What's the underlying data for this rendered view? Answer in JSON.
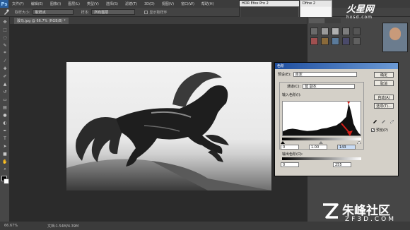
{
  "app": {
    "logo": "Ps"
  },
  "menu": [
    "文件(F)",
    "编辑(E)",
    "图像(I)",
    "图层(L)",
    "类型(Y)",
    "选择(S)",
    "滤镜(T)",
    "3D(D)",
    "视图(V)",
    "窗口(W)",
    "帮助(H)"
  ],
  "options": {
    "size_label": "取样大小:",
    "size_value": "取样点",
    "sample_label": "样本:",
    "sample_value": "所有图层",
    "show_ring": "显示取样环"
  },
  "document": {
    "tab": "骏马.jpg @ 66.7% (RGB/8) *"
  },
  "status": {
    "zoom": "66.67%",
    "doc": "文档:1.54M/4.39M"
  },
  "plugins": {
    "panel1_title": "HDR Efex Pro 2",
    "panel2_title": "Dfine 2"
  },
  "levels": {
    "title": "色阶",
    "preset_label": "预设(E):",
    "preset_value": "自定",
    "channel_label": "通道(C):",
    "channel_value": "蓝 副本",
    "input_label": "输入色阶(I):",
    "input_black": "0",
    "input_gamma": "1.00",
    "input_white": "143",
    "output_label": "输出色阶(O):",
    "output_black": "0",
    "output_white": "255",
    "ok": "确定",
    "cancel": "取消",
    "auto": "自动(A)",
    "options": "选项(T)...",
    "preview": "预览(P)",
    "preview_checked": true
  },
  "watermark": {
    "bottom_cn": "朱峰社区",
    "bottom_en": "ZF3D.COM",
    "top_cn": "火星网",
    "top_en": "hxsd.com"
  },
  "colors": {
    "accent": "#1f4e9e",
    "watermark": "#ffffff",
    "histogram": "#111111",
    "highlight_arrow": "#d6201a"
  },
  "chart_data": {
    "type": "area",
    "title": "",
    "xlabel": "",
    "ylabel": "",
    "xlim": [
      0,
      255
    ],
    "ylim": [
      0,
      100
    ],
    "x": [
      0,
      16,
      32,
      48,
      64,
      80,
      96,
      112,
      128,
      144,
      160,
      176,
      192,
      208,
      216,
      224,
      232,
      240,
      248,
      255
    ],
    "values": [
      12,
      18,
      20,
      18,
      15,
      13,
      14,
      16,
      20,
      22,
      26,
      30,
      40,
      55,
      95,
      70,
      35,
      20,
      8,
      2
    ]
  }
}
